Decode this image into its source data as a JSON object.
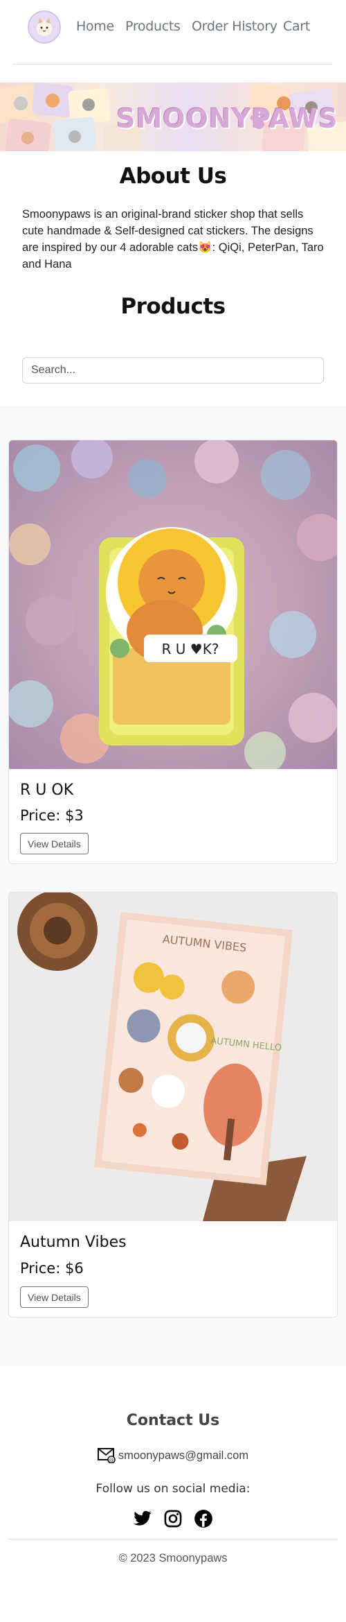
{
  "nav": {
    "logo_alt": "Smoonypaws logo",
    "links": [
      "Home",
      "Products",
      "Order History",
      "Cart"
    ]
  },
  "banner": {
    "text": "SMOONYPAWS"
  },
  "about": {
    "title": "About Us",
    "text": "Smoonypaws is an original-brand sticker shop that sells cute handmade & Self-designed cat stickers. The designs are inspired by our 4 adorable cats😻: QiQi, PeterPan, Taro and Hana"
  },
  "products_section": {
    "title": "Products",
    "search_placeholder": "Search..."
  },
  "products": [
    {
      "name": "R U OK",
      "price": "Price: $3",
      "button": "View Details",
      "sticker_text": "R U ♥K?"
    },
    {
      "name": "Autumn Vibes",
      "price": "Price: $6",
      "button": "View Details",
      "sticker_title": "AUTUMN VIBES",
      "sticker_text": "AUTUMN HELLO"
    }
  ],
  "footer": {
    "contact_title": "Contact Us",
    "email": "smoonypaws@gmail.com",
    "follow_text": "Follow us on social media:",
    "copyright": "© 2023 Smoonypaws"
  }
}
